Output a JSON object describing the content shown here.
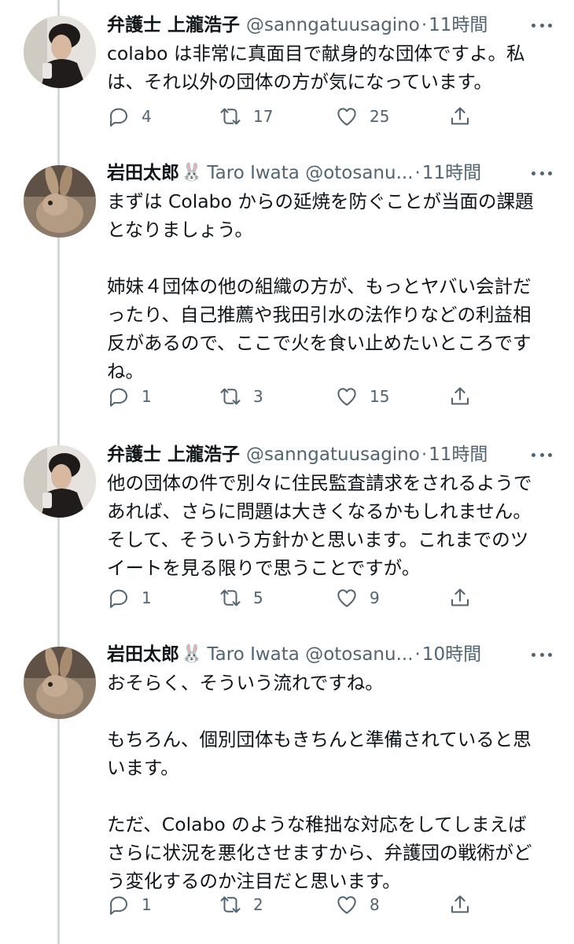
{
  "tweets": [
    {
      "name": "弁護士 上瀧浩子",
      "name_badge": "",
      "handle": "@sanngatuusagino",
      "time": "11時間",
      "text": "colabo は非常に真面目で献身的な団体ですよ。私\nは、それ以外の団体の方が気になっています。",
      "replies": "4",
      "retweets": "17",
      "likes": "25",
      "avatar": "woman-photo"
    },
    {
      "name": "岩田太郎",
      "name_badge": "🐰",
      "handle": "Taro Iwata @otosanu...",
      "time": "11時間",
      "text": "まずは Colabo からの延焼を防ぐことが当面の課題\nとなりましょう。\n\n姉妹４団体の他の組織の方が、もっとヤバい会計だ\nったり、自己推薦や我田引水の法作りなどの利益相\n反があるので、ここで火を食い止めたいところです\nね。",
      "replies": "1",
      "retweets": "3",
      "likes": "15",
      "avatar": "rabbit-photo"
    },
    {
      "name": "弁護士 上瀧浩子",
      "name_badge": "",
      "handle": "@sanngatuusagino",
      "time": "11時間",
      "text": "他の団体の件で別々に住民監査請求をされるようで\nあれば、さらに問題は大きくなるかもしれません。\nそして、そういう方針かと思います。これまでのツ\nイートを見る限りで思うことですが。",
      "replies": "1",
      "retweets": "5",
      "likes": "9",
      "avatar": "woman-photo"
    },
    {
      "name": "岩田太郎",
      "name_badge": "🐰",
      "handle": "Taro Iwata @otosanu...",
      "time": "10時間",
      "text": "おそらく、そういう流れですね。\n\nもちろん、個別団体もきちんと準備されていると思\nいます。\n\nただ、Colabo のような稚拙な対応をしてしまえば\nさらに状況を悪化させますから、弁護団の戦術がど\nう変化するのか注目だと思います。",
      "replies": "1",
      "retweets": "2",
      "likes": "8",
      "avatar": "rabbit-photo"
    }
  ],
  "separator": "·",
  "icons": {
    "reply": "reply-icon",
    "retweet": "retweet-icon",
    "like": "like-icon",
    "share": "share-icon",
    "more": "more-icon"
  },
  "colors": {
    "text": "#0f1419",
    "secondary": "#536471",
    "thread_line": "#cfd9de"
  }
}
